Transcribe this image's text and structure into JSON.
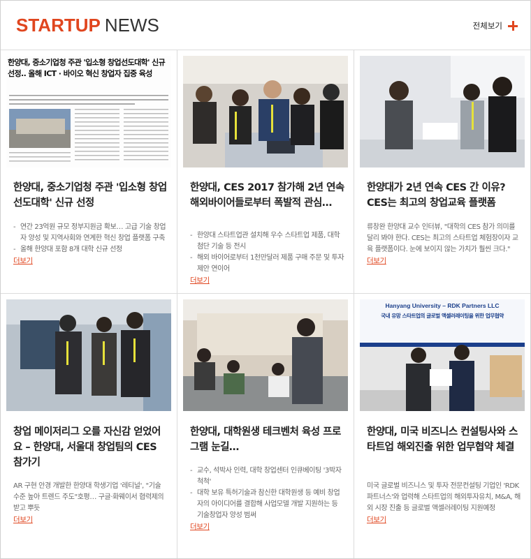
{
  "header": {
    "title_accent": "STARTUP",
    "title_rest": "NEWS",
    "view_all_label": "전체보기"
  },
  "colors": {
    "accent": "#e0461f",
    "border": "#dcdcdc"
  },
  "articles": [
    {
      "image_desc": "newspaper-clipping",
      "image_caption": "한양대, 중소기업청 주관 '입소형 창업선도대학' 신규 선정.. 올해 ICT · 바이오 혁신 창업자 집중 육성",
      "title": "한양대, 중소기업청 주관 '입소형 창업선도대학' 신규 선정",
      "bullets": [
        "연간 23억원 규모 정부지원금 확보… 고급 기술 창업자 양성 및 지역사회와 연계한 혁신 창업 플랫폼 구축",
        "올해 한양대 포함 8개 대학 신규 선정"
      ],
      "more": "더보기"
    },
    {
      "image_desc": "ces-booth-crowd",
      "title": "한양대, CES 2017 참가해 2년 연속 해외바이어들로부터 폭발적 관심…",
      "bullets": [
        "한양대 스타트업관 설치해 우수 스타트업 제품, 대학 첨단 기술 등 전시",
        "해외 바이어로부터 1천만달러 제품 구매 주문 및 투자제안 연이어"
      ],
      "more": "더보기"
    },
    {
      "image_desc": "ces-booth-demo",
      "title": "한양대가 2년 연속 CES 간 이유? CES는 최고의 창업교육 플랫폼",
      "paragraph": "류창완 한양대 교수 인터뷰, \"대학의 CES 참가 의미를 달리 봐야 한다. CES는 최고의 스타트업 체험장이자 교육 플랫폼이다. 눈에 보이지 않는 가치가 훨씬 크다.\"",
      "more": "더보기"
    },
    {
      "image_desc": "students-at-ces",
      "title": "창업 메이저리그 오를 자신감 얻었어요 – 한양대, 서울대 창업팀의 CES 참가기",
      "paragraph": "AR 구현 안경 개발한 한양대 학생기업 '레티널', \"기술 수준 높아 트렌드 주도\"호평… 구글·화웨이서 협력제의 받고 뿌듯",
      "more": "더보기"
    },
    {
      "image_desc": "lab-workshop",
      "title": "한양대, 대학원생 테크벤처 육성 프로그램 눈길…",
      "bullets": [
        "교수, 석박사 인력, 대학 창업센터 인큐베이팅 '3박자 척척'",
        "대학 보유 특허기술과 참신한 대학원생 등 예비 창업자의 아이디어를 결합해 사업모델 개발 지원하는 등 기술창업자 양성 범써"
      ],
      "more": "더보기"
    },
    {
      "image_desc": "mou-signing",
      "banner_line1": "Hanyang University – RDK Partners LLC",
      "banner_line2": "국내 유망 스타트업의 글로벌 액셀러레이팅을 위한 업무협약",
      "title": "한양대, 미국 비즈니스 컨설팅사와 스타트업 해외진출 위한 업무협약 체결",
      "paragraph": "미국 글로벌 비즈니스 및 투자 전문컨설팅 기업인 'RDK 파트너스'와 업력해 스타트업의 해외투자유치, M&A, 해외 시장 진출 등 글로벌 액셀러레이팅 지원예정",
      "more": "더보기"
    }
  ]
}
